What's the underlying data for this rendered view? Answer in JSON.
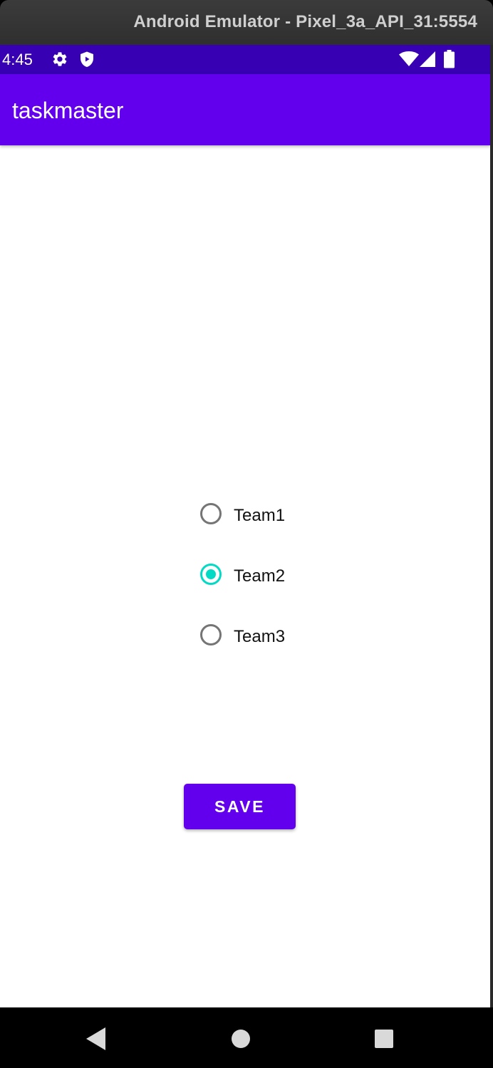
{
  "window": {
    "title": "Android Emulator - Pixel_3a_API_31:5554"
  },
  "status_bar": {
    "time": "4:45",
    "icons": [
      "gear-icon",
      "shield-icon",
      "wifi-icon",
      "cellular-signal-icon",
      "battery-icon"
    ]
  },
  "app_bar": {
    "title": "taskmaster"
  },
  "team_options": [
    {
      "label": "Team1",
      "checked": false
    },
    {
      "label": "Team2",
      "checked": true
    },
    {
      "label": "Team3",
      "checked": false
    }
  ],
  "save_button": {
    "label": "SAVE"
  },
  "nav_bar": {
    "icons": [
      "back-icon",
      "home-icon",
      "recents-icon"
    ]
  },
  "colors": {
    "status_bar": "#3700b3",
    "primary": "#6200ee",
    "accent": "#03dac5"
  }
}
